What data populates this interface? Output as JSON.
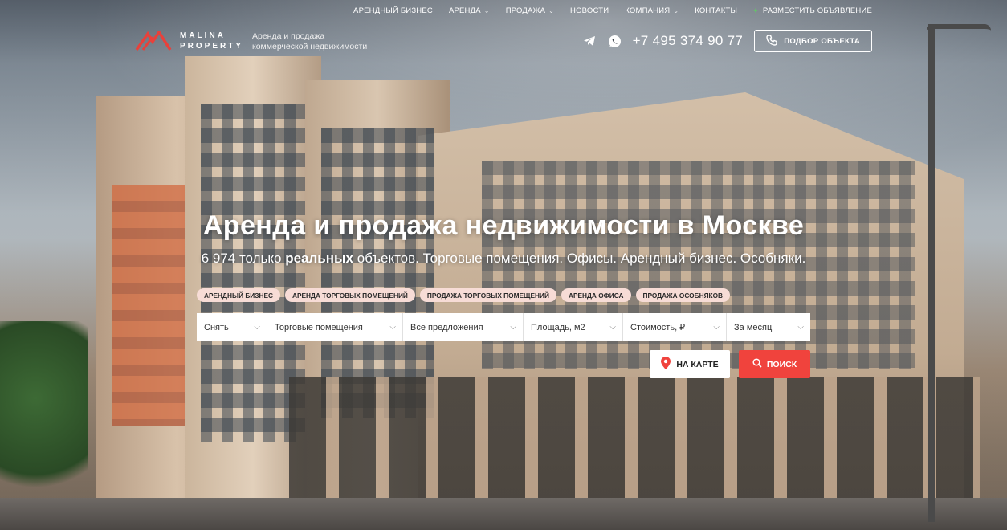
{
  "colors": {
    "accent": "#f0433d",
    "chip_bg": "#f7dcd6",
    "online_green": "#5cd35c"
  },
  "top_nav": {
    "items": [
      {
        "label": "АРЕНДНЫЙ БИЗНЕС",
        "dropdown": false
      },
      {
        "label": "АРЕНДА",
        "dropdown": true
      },
      {
        "label": "ПРОДАЖА",
        "dropdown": true
      },
      {
        "label": "НОВОСТИ",
        "dropdown": false
      },
      {
        "label": "КОМПАНИЯ",
        "dropdown": true
      },
      {
        "label": "КОНТАКТЫ",
        "dropdown": false
      }
    ],
    "post_ad": {
      "label": "РАЗМЕСТИТЬ ОБЪЯВЛЕНИЕ",
      "icon": "plus-icon"
    }
  },
  "header": {
    "logo": {
      "line1": "MALINA",
      "line2": "PROPERTY"
    },
    "tagline": {
      "line1": "Аренда и продажа",
      "line2": "коммерческой недвижимости"
    },
    "phone": "+7 495 374 90 77",
    "pick_button": "ПОДБОР ОБЪЕКТА",
    "icons": [
      "telegram-icon",
      "whatsapp-icon",
      "phone-icon"
    ]
  },
  "hero": {
    "title": "Аренда и продажа недвижимости в Москве",
    "subtitle_prefix": "6 974 только ",
    "subtitle_bold": "реальных",
    "subtitle_suffix": " объектов. Торговые помещения. Офисы. Арендный бизнес. Особняки."
  },
  "chips": [
    "АРЕНДНЫЙ БИЗНЕС",
    "АРЕНДА ТОРГОВЫХ ПОМЕЩЕНИЙ",
    "ПРОДАЖА ТОРГОВЫХ ПОМЕЩЕНИЙ",
    "АРЕНДА ОФИСА",
    "ПРОДАЖА ОСОБНЯКОВ"
  ],
  "search": {
    "deal": "Снять",
    "type": "Торговые помещения",
    "offers": "Все предложения",
    "area": "Площадь, м2",
    "price": "Стоимость, ₽",
    "period": "За месяц"
  },
  "actions": {
    "map": "НА КАРТЕ",
    "find": "ПОИСК"
  }
}
